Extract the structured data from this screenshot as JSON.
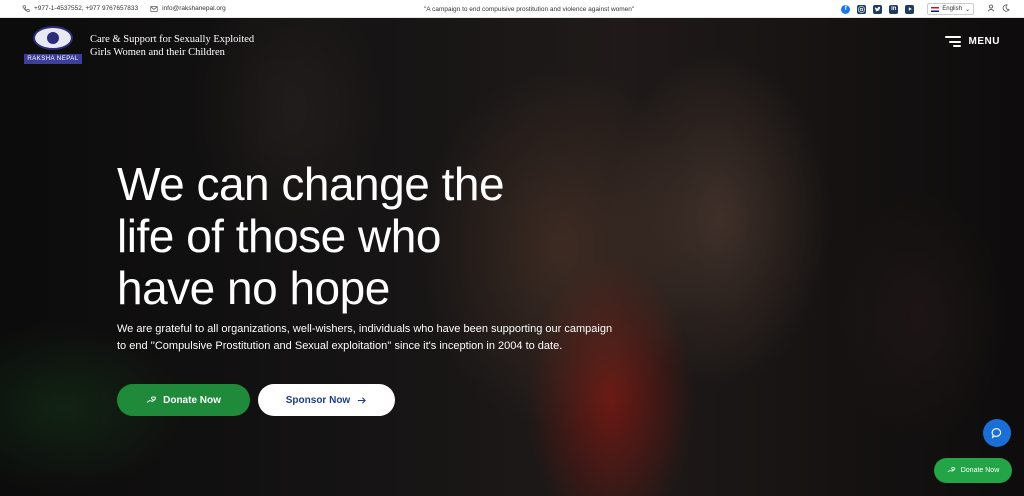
{
  "topbar": {
    "phone": "+977-1-4537552, +977 9767657833",
    "email": "info@rakshanepal.org",
    "tagline": "\"A campaign to end compulsive prostitution and violence against women\"",
    "language": "English",
    "social_icons": [
      "facebook-icon",
      "instagram-icon",
      "twitter-icon",
      "linkedin-icon",
      "youtube-icon"
    ]
  },
  "header": {
    "logo_text": "RAKSHA NEPAL",
    "org_name_line1": "Care & Support for Sexually Exploited",
    "org_name_line2": "Girls Women and their Children",
    "menu_label": "MENU"
  },
  "hero": {
    "headline_line1": "We can change the",
    "headline_line2": "life of those who",
    "headline_line3": "have no hope",
    "subtext": "We are grateful to all organizations, well-wishers, individuals who have been supporting our campaign to end ''Compulsive Prostitution and Sexual exploitation'' since it's inception in 2004 to date.",
    "donate_label": "Donate Now",
    "sponsor_label": "Sponsor Now"
  },
  "floating": {
    "donate_label": "Donate Now"
  },
  "colors": {
    "green": "#1f8a3a",
    "blue": "#1a6fd6",
    "logo_blue": "#3e3f9a"
  }
}
